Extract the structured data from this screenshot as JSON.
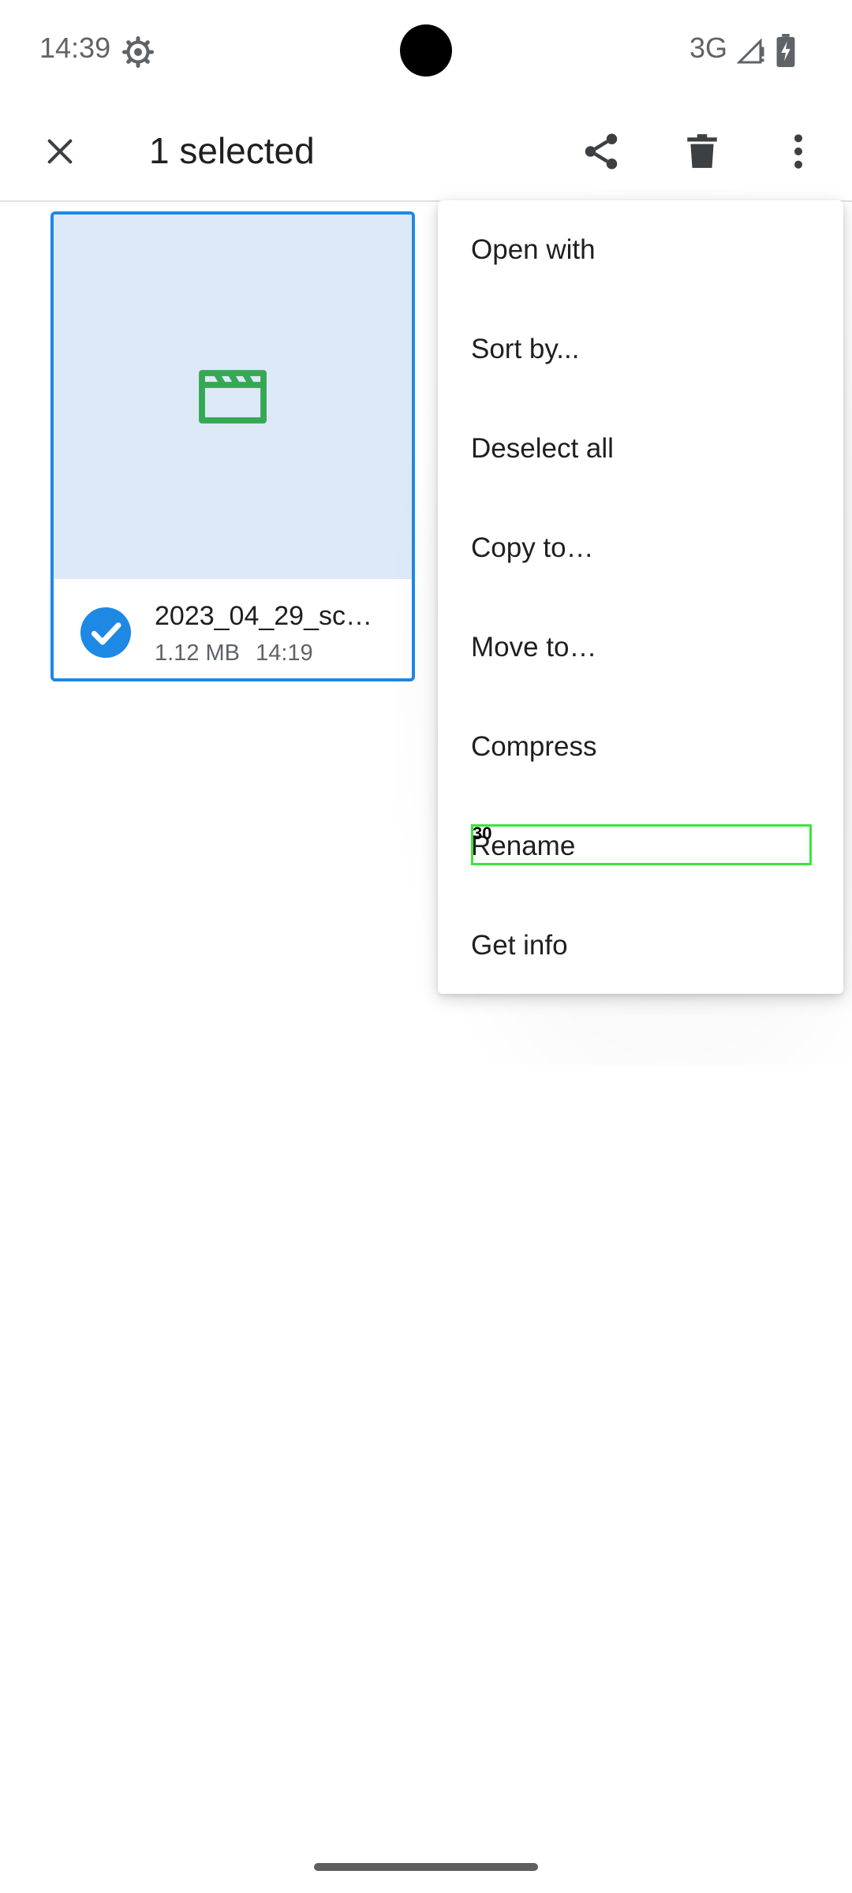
{
  "status_bar": {
    "time": "14:39",
    "network": "3G",
    "icons": [
      "settings-gear-icon",
      "signal-icon",
      "battery-charging-icon"
    ]
  },
  "action_bar": {
    "title": "1 selected",
    "icons": [
      "close-icon",
      "share-icon",
      "delete-icon",
      "more-vert-icon"
    ]
  },
  "file": {
    "name": "2023_04_29_sc…",
    "size": "1.12 MB",
    "time": "14:19",
    "selected": true,
    "type_icon": "video-clapperboard-icon"
  },
  "menu": {
    "items": [
      {
        "label": "Open with"
      },
      {
        "label": "Sort by..."
      },
      {
        "label": "Deselect all"
      },
      {
        "label": "Copy to…"
      },
      {
        "label": "Move to…"
      },
      {
        "label": "Compress"
      },
      {
        "label": "Rename"
      },
      {
        "label": "Get info"
      }
    ],
    "highlight_badge": "30"
  },
  "colors": {
    "accent": "#1e88e5",
    "thumb_bg": "#dde9f6",
    "video_icon": "#34a853",
    "highlight": "#39e639"
  }
}
